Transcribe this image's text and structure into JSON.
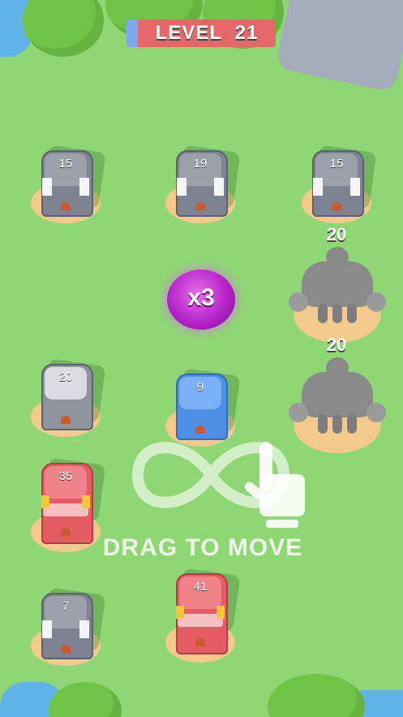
{
  "hud": {
    "level_label": "LEVEL",
    "level_number": "21"
  },
  "towers": [
    {
      "id": "t1",
      "count": "15",
      "type": "grey"
    },
    {
      "id": "t2",
      "count": "19",
      "type": "grey"
    },
    {
      "id": "t3",
      "count": "15",
      "type": "grey"
    },
    {
      "id": "t4",
      "count": "20",
      "type": "white"
    },
    {
      "id": "t5",
      "count": "9",
      "type": "blue"
    },
    {
      "id": "t6",
      "count": "35",
      "type": "red"
    },
    {
      "id": "t7",
      "count": "7",
      "type": "grey"
    },
    {
      "id": "t8",
      "count": "41",
      "type": "red"
    }
  ],
  "giants": [
    {
      "id": "g1",
      "count": "20"
    },
    {
      "id": "g2",
      "count": "20"
    }
  ],
  "bonus": {
    "label": "x3",
    "color": "#b624c9"
  },
  "hint": {
    "text": "DRAG TO MOVE",
    "icons": [
      "infinity-gesture-icon",
      "hand-pointer-icon"
    ]
  },
  "colors": {
    "grass": "#8fd774",
    "water": "#5fb3e6",
    "banner": "#e66767",
    "player_blue": "#4f8fe6",
    "enemy_red": "#e65c63",
    "neutral_grey": "#7e8391"
  }
}
